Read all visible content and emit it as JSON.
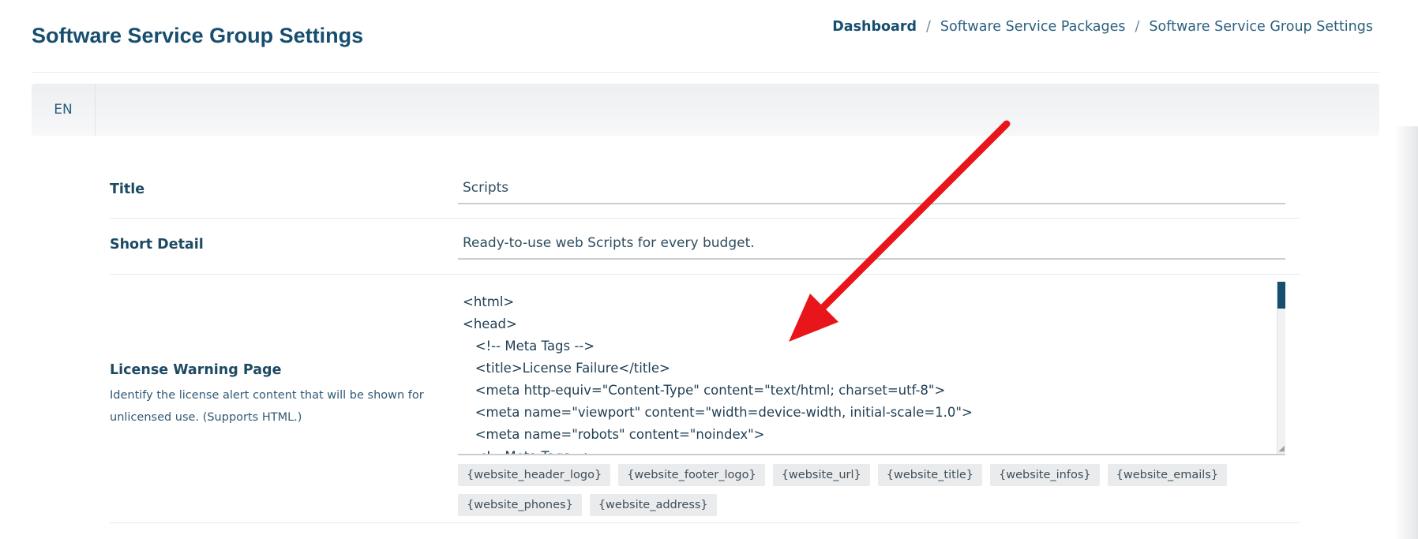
{
  "header": {
    "title": "Software Service Group Settings",
    "breadcrumb": [
      "Dashboard",
      "Software Service Packages",
      "Software Service Group Settings"
    ],
    "separator": "/"
  },
  "language_tabs": [
    "EN"
  ],
  "form": {
    "title": {
      "label": "Title",
      "value": "Scripts"
    },
    "short_detail": {
      "label": "Short Detail",
      "value": "Ready-to-use web Scripts for every budget."
    },
    "license_warning": {
      "label": "License Warning Page",
      "description": "Identify the license alert content that will be shown for unlicensed use. (Supports HTML.)",
      "code_lines": [
        "<html>",
        "<head>",
        "   <!-- Meta Tags -->",
        "   <title>License Failure</title>",
        "   <meta http-equiv=\"Content-Type\" content=\"text/html; charset=utf-8\">",
        "   <meta name=\"viewport\" content=\"width=device-width, initial-scale=1.0\">",
        "   <meta name=\"robots\" content=\"noindex\">",
        "   <!-- Meta Tags -->"
      ],
      "tags": [
        "{website_header_logo}",
        "{website_footer_logo}",
        "{website_url}",
        "{website_title}",
        "{website_infos}",
        "{website_emails}",
        "{website_phones}",
        "{website_address}"
      ]
    }
  },
  "colors": {
    "accent": "#174e6f",
    "annotation_arrow": "#e8151b"
  }
}
